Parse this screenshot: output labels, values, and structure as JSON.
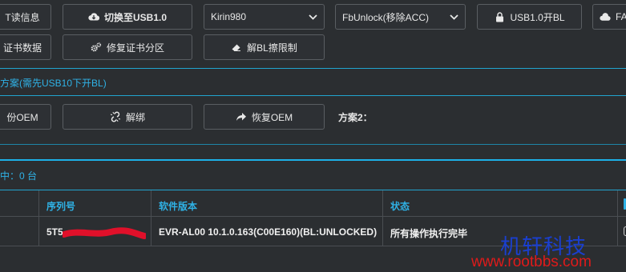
{
  "toolbar_row1": {
    "read_cert": "T读信息",
    "switch_usb": "切换至USB1.0",
    "chip_select": "Kirin980",
    "mode_select": "FbUnlock(移除ACC)",
    "usb_open_bl": "USB1.0开BL",
    "fastboot": "FAS"
  },
  "toolbar_row2": {
    "cert_data": "证书数据",
    "repair_cert": "修复证书分区",
    "unlock_bl": "解BL擦限制"
  },
  "scheme1": {
    "label": "方案(需先USB10下开BL)"
  },
  "toolbar_row3": {
    "backup_oem": "份OEM",
    "unbind": "解绑",
    "restore_oem": "恢复OEM",
    "scheme2_label": "方案2："
  },
  "online": {
    "label": "中：0 台"
  },
  "table": {
    "headers": [
      "序列号",
      "软件版本",
      "状态"
    ],
    "rows": [
      {
        "serial": "5T5",
        "version": "EVR-AL00 10.1.0.163(C00E160)(BL:UNLOCKED)",
        "status": "所有操作执行完毕"
      }
    ]
  },
  "watermark": {
    "line1": "机轩科技",
    "line2": "www.rootbbs.com"
  },
  "colors": {
    "accent": "#2fb2e6",
    "background": "#2b2e31",
    "redact": "#e0102a",
    "watermark_line1": "#1a3fd0",
    "watermark_line2": "#e01a1a"
  }
}
